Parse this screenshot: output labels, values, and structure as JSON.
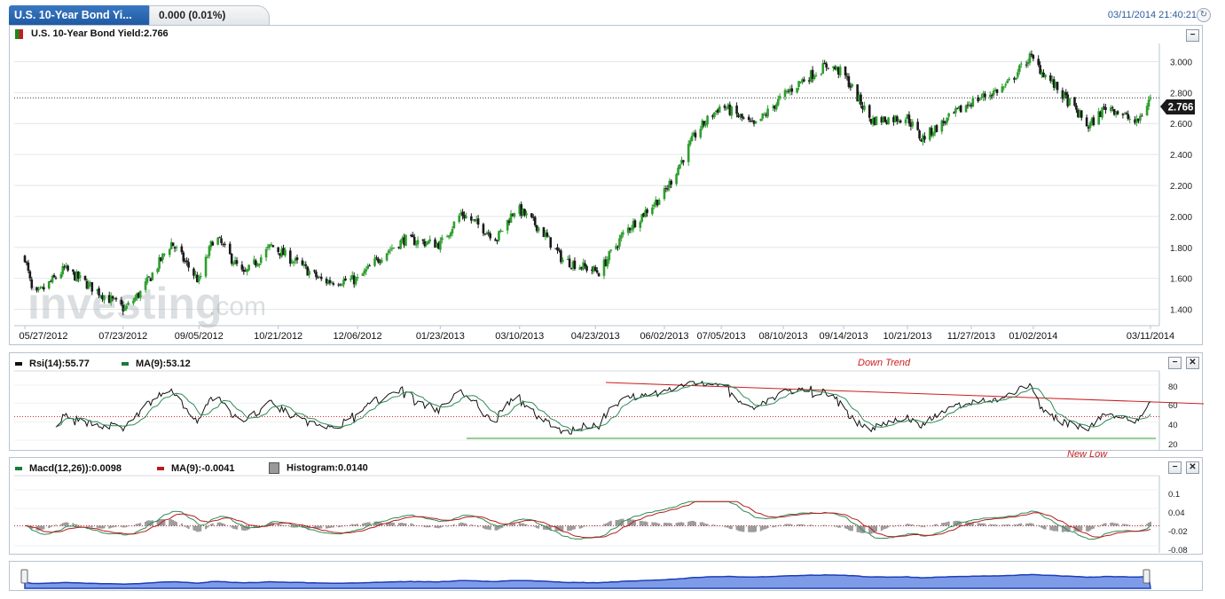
{
  "header": {
    "tab_title": "U.S. 10-Year Bond Yi...",
    "tab_change": "0.000 (0.01%)",
    "timestamp": "03/11/2014 21:40:21",
    "refresh_icon": "refresh-icon"
  },
  "main_panel": {
    "label": "U.S. 10-Year Bond Yield:2.766",
    "current_value": "2.766",
    "watermark_1": "investing",
    "watermark_2": ".com",
    "icon": "candle-icon"
  },
  "rsi_panel": {
    "legend_rsi": "Rsi(14):55.77",
    "legend_ma": "MA(9):53.12",
    "annotation_down": "Down Trend",
    "annotation_low": "New Low",
    "ticks": [
      "80",
      "60",
      "40",
      "20"
    ]
  },
  "macd_panel": {
    "legend_macd": "Macd(12,26)):0.0098",
    "legend_ma": "MA(9):-0.0041",
    "legend_hist": "Histogram:0.0140",
    "ticks": [
      "0.1",
      "0.04",
      "-0.02",
      "-0.08"
    ]
  },
  "colors": {
    "up": "#2e9e2e",
    "down": "#1a1a1a",
    "accent": "#1f5aa3",
    "trend_red": "#cc1f1f",
    "trend_green": "#2e9e2e",
    "navigator": "#6d8ee6"
  },
  "chart_data": {
    "type": "candlestick",
    "title": "U.S. 10-Year Bond Yield",
    "x_tick_labels": [
      "05/27/2012",
      "07/23/2012",
      "09/05/2012",
      "10/21/2012",
      "12/06/2012",
      "01/23/2013",
      "03/10/2013",
      "04/23/2013",
      "06/02/2013",
      "07/05/2013",
      "08/10/2013",
      "09/14/2013",
      "10/21/2013",
      "11/27/2013",
      "01/02/2014",
      "03/11/2014"
    ],
    "y_tick_labels": [
      "3.000",
      "2.800",
      "2.600",
      "2.400",
      "2.200",
      "2.000",
      "1.800",
      "1.600",
      "1.400"
    ],
    "ylim": [
      1.3,
      3.1
    ],
    "last_value": 2.766,
    "anchors": [
      {
        "date": "05/27/2012",
        "y": 1.74
      },
      {
        "date": "06/01/2012",
        "y": 1.47
      },
      {
        "date": "06/19/2012",
        "y": 1.66
      },
      {
        "date": "07/24/2012",
        "y": 1.4
      },
      {
        "date": "08/03/2012",
        "y": 1.52
      },
      {
        "date": "08/20/2012",
        "y": 1.83
      },
      {
        "date": "09/05/2012",
        "y": 1.58
      },
      {
        "date": "09/14/2012",
        "y": 1.88
      },
      {
        "date": "10/01/2012",
        "y": 1.62
      },
      {
        "date": "10/17/2012",
        "y": 1.81
      },
      {
        "date": "10/29/2012",
        "y": 1.72
      },
      {
        "date": "11/16/2012",
        "y": 1.58
      },
      {
        "date": "12/06/2012",
        "y": 1.59
      },
      {
        "date": "12/21/2012",
        "y": 1.76
      },
      {
        "date": "01/02/2013",
        "y": 1.85
      },
      {
        "date": "01/23/2013",
        "y": 1.82
      },
      {
        "date": "02/04/2013",
        "y": 2.02
      },
      {
        "date": "02/25/2013",
        "y": 1.86
      },
      {
        "date": "03/08/2013",
        "y": 2.06
      },
      {
        "date": "03/22/2013",
        "y": 1.92
      },
      {
        "date": "04/04/2013",
        "y": 1.72
      },
      {
        "date": "04/25/2013",
        "y": 1.64
      },
      {
        "date": "05/10/2013",
        "y": 1.9
      },
      {
        "date": "06/02/2013",
        "y": 2.15
      },
      {
        "date": "06/21/2013",
        "y": 2.55
      },
      {
        "date": "07/05/2013",
        "y": 2.72
      },
      {
        "date": "07/24/2013",
        "y": 2.58
      },
      {
        "date": "08/10/2013",
        "y": 2.78
      },
      {
        "date": "08/21/2013",
        "y": 2.88
      },
      {
        "date": "09/05/2013",
        "y": 2.98
      },
      {
        "date": "09/14/2013",
        "y": 2.92
      },
      {
        "date": "09/30/2013",
        "y": 2.62
      },
      {
        "date": "10/21/2013",
        "y": 2.64
      },
      {
        "date": "10/29/2013",
        "y": 2.5
      },
      {
        "date": "11/27/2013",
        "y": 2.74
      },
      {
        "date": "12/17/2013",
        "y": 2.84
      },
      {
        "date": "12/31/2013",
        "y": 3.03
      },
      {
        "date": "01/10/2014",
        "y": 2.9
      },
      {
        "date": "01/24/2014",
        "y": 2.72
      },
      {
        "date": "02/03/2014",
        "y": 2.58
      },
      {
        "date": "02/14/2014",
        "y": 2.72
      },
      {
        "date": "03/03/2014",
        "y": 2.6
      },
      {
        "date": "03/11/2014",
        "y": 2.77
      }
    ]
  }
}
